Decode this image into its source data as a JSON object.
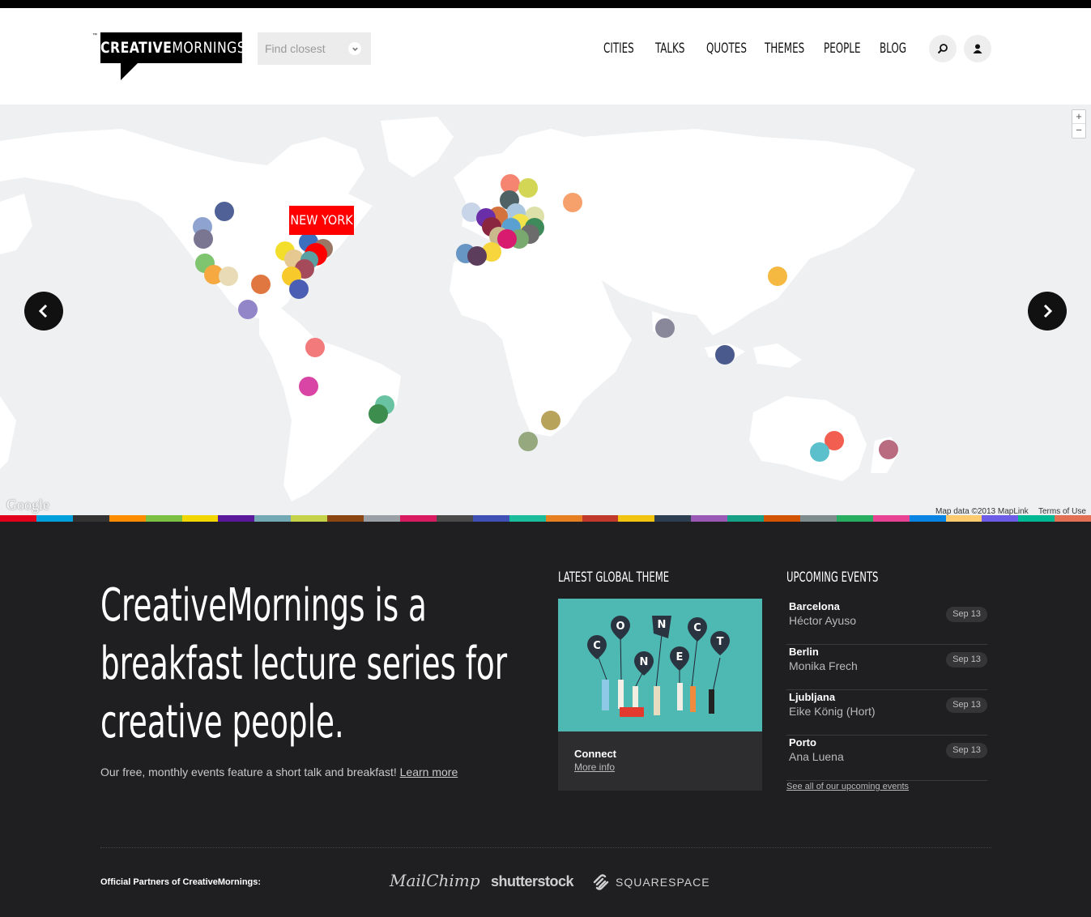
{
  "header": {
    "logo_bold": "CREATIVE",
    "logo_light": "MORNINGS",
    "logo_tm": "™",
    "find_placeholder": "Find closest",
    "nav": [
      "CITIES",
      "TALKS",
      "QUOTES",
      "THEMES",
      "PEOPLE",
      "BLOG"
    ]
  },
  "map": {
    "highlight_label": "NEW YORK",
    "zoom_in": "+",
    "zoom_out": "−",
    "google_mark": "Google",
    "map_data": "Map data ©2013 MapLink",
    "terms": "Terms of Use"
  },
  "hero": {
    "line1": "CreativeMornings is a",
    "line2": "breakfast lecture series for",
    "line3": "creative people.",
    "sub": "Our free, monthly events feature a short talk and breakfast!",
    "learn_more": "Learn more"
  },
  "theme": {
    "heading": "LATEST GLOBAL THEME",
    "name": "Connect",
    "more": "More info",
    "balloon_letters": [
      "C",
      "O",
      "N",
      "N",
      "E",
      "C",
      "T"
    ]
  },
  "events": {
    "heading": "UPCOMING EVENTS",
    "items": [
      {
        "city": "Barcelona",
        "speaker": "Héctor Ayuso",
        "date": "Sep 13"
      },
      {
        "city": "Berlin",
        "speaker": "Monika Frech",
        "date": "Sep 13"
      },
      {
        "city": "Ljubljana",
        "speaker": "Eike König (Hort)",
        "date": "Sep 13"
      },
      {
        "city": "Porto",
        "speaker": "Ana Luena",
        "date": "Sep 13"
      }
    ],
    "see_all": "See all of our upcoming events"
  },
  "partners": {
    "label": "Official Partners of CreativeMornings:",
    "names": [
      "MailChimp",
      "shutterstock",
      "SQUARESPACE"
    ]
  },
  "colors": {
    "accent_red": "#ff0000",
    "dark_bg": "#1f1f21",
    "theme_teal": "#4db9b2"
  }
}
